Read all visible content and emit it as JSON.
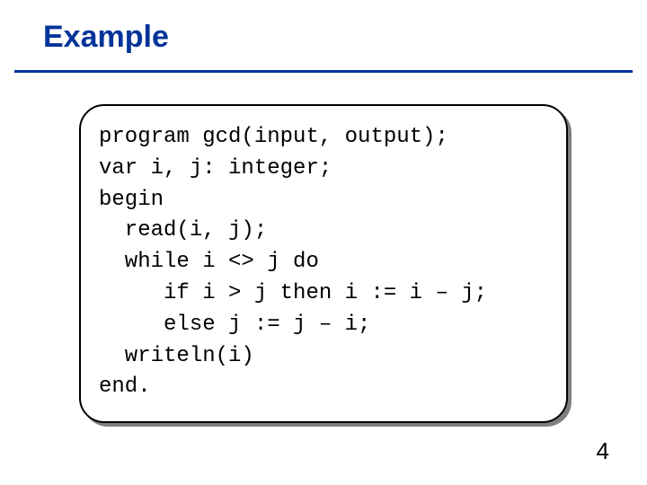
{
  "slide": {
    "title": "Example",
    "page_number": "4",
    "code_lines": [
      "program gcd(input, output);",
      "var i, j: integer;",
      "begin",
      "  read(i, j);",
      "  while i <> j do",
      "     if i > j then i := i – j;",
      "     else j := j – i;",
      "  writeln(i)",
      "end."
    ]
  }
}
